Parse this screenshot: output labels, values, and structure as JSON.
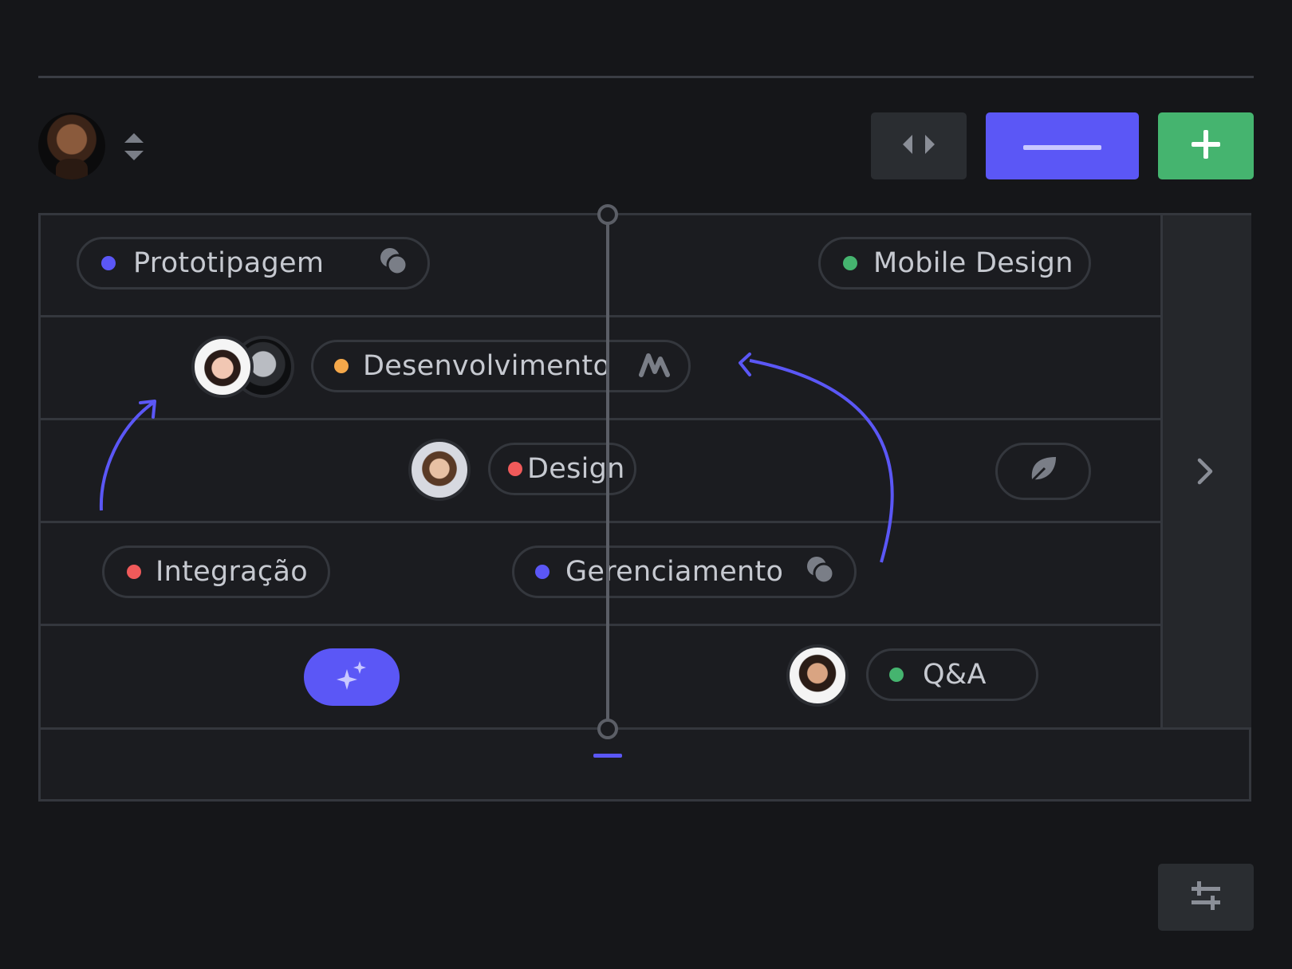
{
  "header": {
    "avatar_icon": "user-avatar",
    "sort_icon": "sort-updown-icon",
    "split_button_icon": "split-horizontal-icon",
    "collapse_button_icon": "minus-icon",
    "add_button_icon": "plus-icon"
  },
  "board": {
    "rows": [
      {
        "items": [
          {
            "label": "Prototipagem",
            "dot_color": "#5b57f6",
            "trailing_icon": "toggle-circles-icon"
          },
          {
            "label": "Mobile Design",
            "dot_color": "#45b46f"
          }
        ]
      },
      {
        "items": [
          {
            "label": "Desenvolvimento",
            "dot_color": "#f5a84a",
            "trailing_icon": "activity-icon",
            "avatars": [
              "user-avatar",
              "user-avatar"
            ]
          }
        ]
      },
      {
        "items": [
          {
            "label": "Design",
            "dot_color": "#f05a5a",
            "avatars": [
              "user-avatar"
            ]
          },
          {
            "label": "",
            "trailing_icon": "leaf-icon"
          }
        ]
      },
      {
        "items": [
          {
            "label": "Integração",
            "dot_color": "#f05a5a"
          },
          {
            "label": "Gerenciamento",
            "dot_color": "#5b57f6",
            "trailing_icon": "toggle-circles-icon"
          }
        ]
      },
      {
        "items": [
          {
            "label": "",
            "trailing_icon": "sparkle-icon"
          },
          {
            "label": "Q&A",
            "dot_color": "#45b46f",
            "avatars": [
              "user-avatar"
            ]
          }
        ]
      }
    ],
    "next_icon": "chevron-right-icon",
    "filter_icon": "sliders-icon"
  },
  "colors": {
    "background": "#151619",
    "board": "#1b1c20",
    "accent": "#5b57f6",
    "success": "#45b46f",
    "warning": "#f5a84a",
    "danger": "#f05a5a"
  }
}
